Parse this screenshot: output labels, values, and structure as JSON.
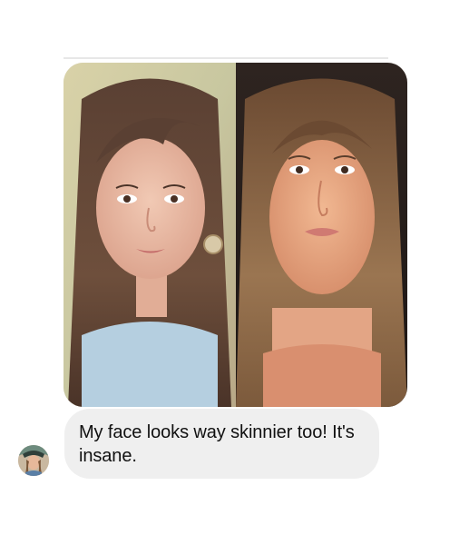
{
  "message": {
    "text": "My face looks way skinnier too! It's insane.",
    "sender_avatar_icon": "profile-avatar",
    "bubble_color": "#efefef"
  },
  "photos": [
    {
      "icon": "before-photo"
    },
    {
      "icon": "after-photo"
    }
  ]
}
